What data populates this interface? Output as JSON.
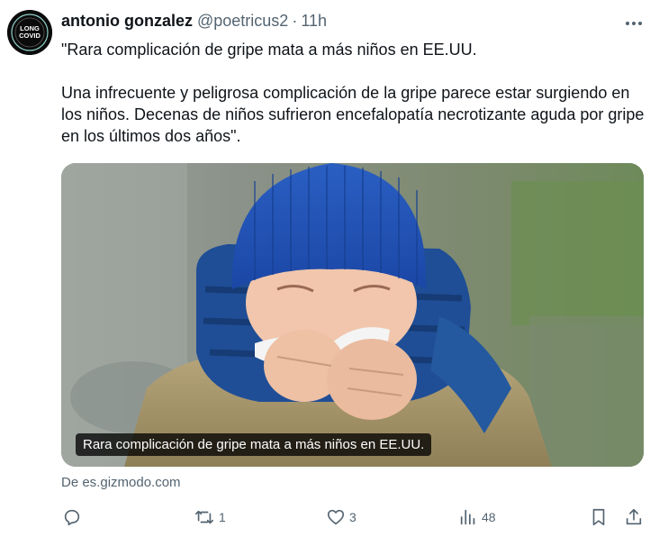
{
  "author": {
    "name": "antonio gonzalez",
    "handle": "@poetricus2",
    "separator": "·",
    "time": "11h",
    "avatar_badge_top": "LONG",
    "avatar_badge_bottom": "COVID"
  },
  "tweet": {
    "paragraph_1": "\"Rara complicación de gripe mata a más niños en EE.UU.",
    "paragraph_2": "Una infrecuente y peligrosa complicación de la gripe parece estar surgiendo en los niños. Decenas de niños sufrieron encefalopatía necrotizante aguda por gripe  en los últimos dos años\"."
  },
  "media": {
    "caption": "Rara complicación de gripe mata a más niños en EE.UU."
  },
  "source": {
    "text": "De es.gizmodo.com"
  },
  "actions": {
    "reply": {
      "icon": "reply-icon",
      "count": ""
    },
    "retweet": {
      "icon": "retweet-icon",
      "count": "1"
    },
    "like": {
      "icon": "heart-icon",
      "count": "3"
    },
    "views": {
      "icon": "views-icon",
      "count": "48"
    },
    "bookmark": {
      "icon": "bookmark-icon"
    },
    "share": {
      "icon": "share-icon"
    }
  },
  "colors": {
    "text": "#0f1419",
    "secondary": "#536471",
    "caption_bg": "#000000"
  }
}
